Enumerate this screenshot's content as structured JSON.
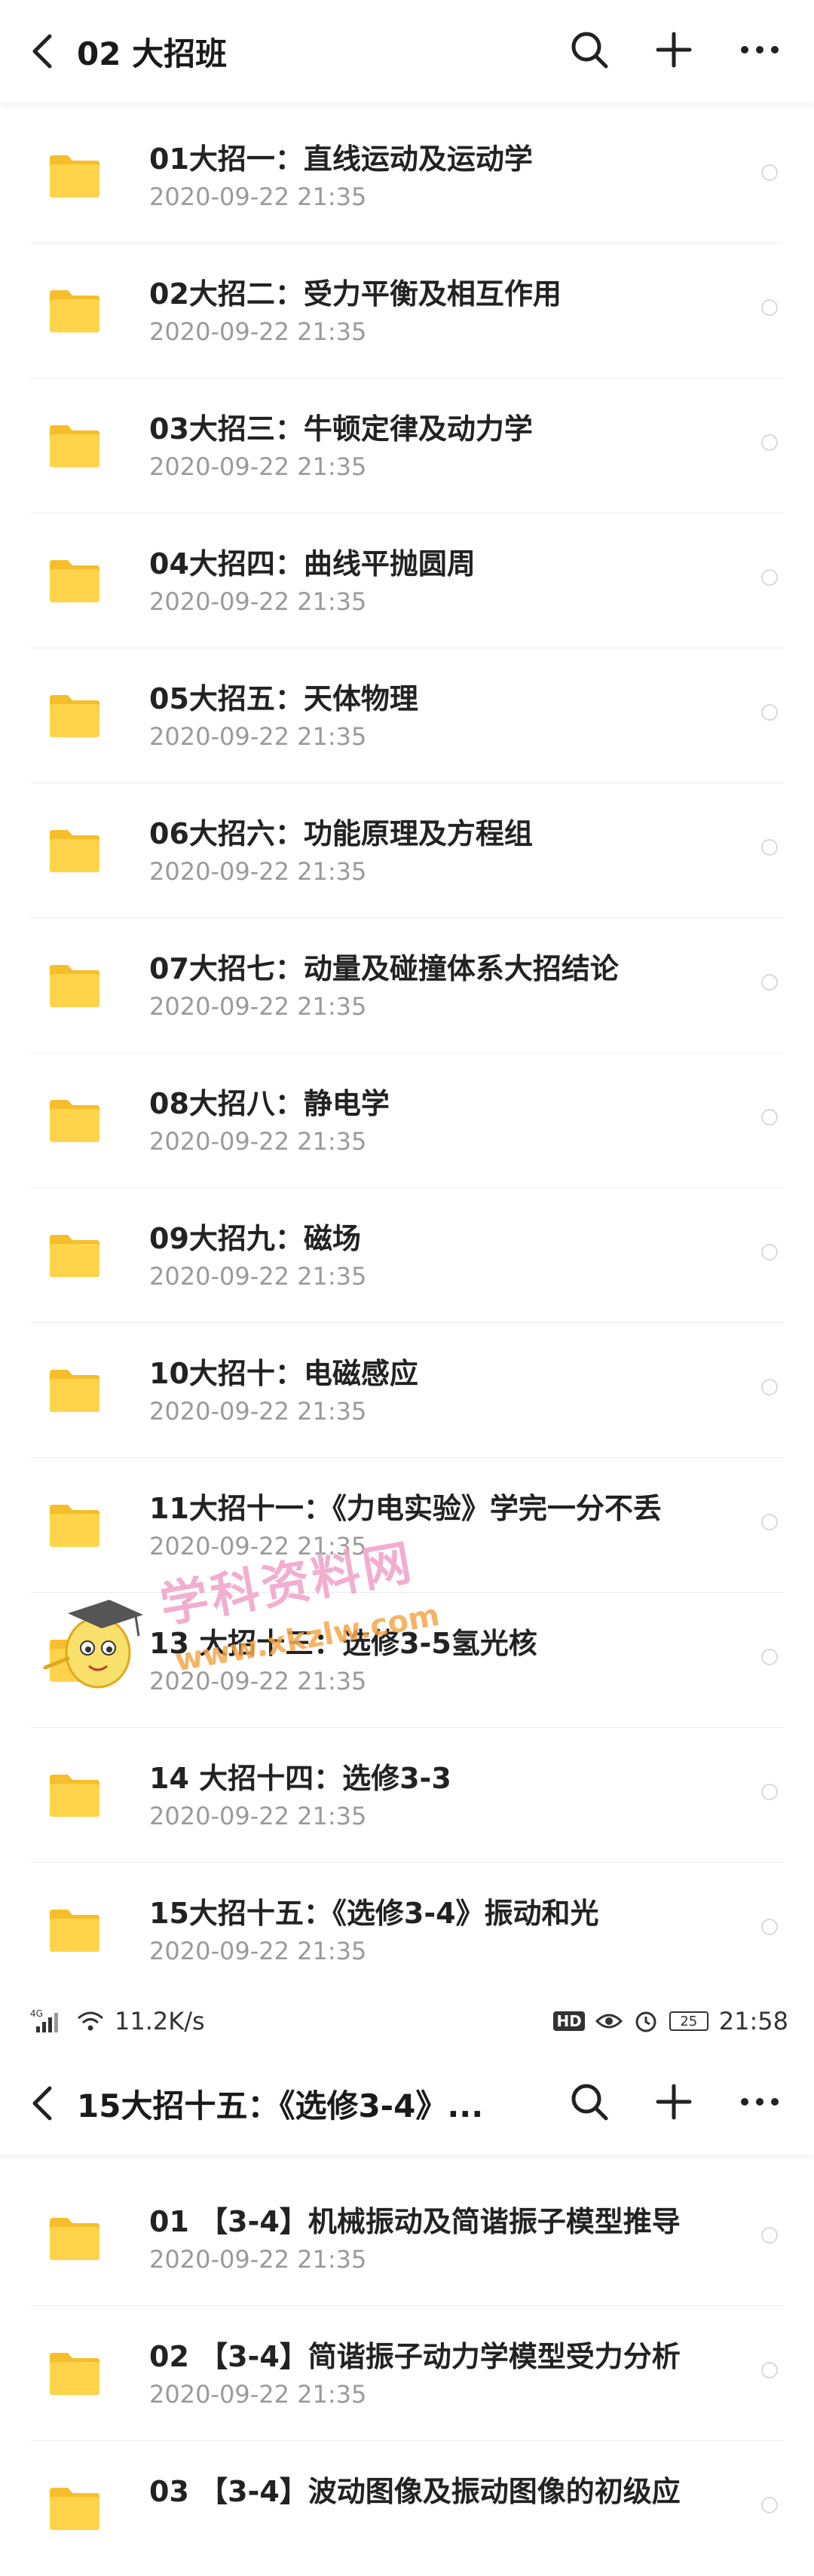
{
  "screen1": {
    "title": "02 大招班",
    "items": [
      {
        "name": "01大招一：直线运动及运动学",
        "date": "2020-09-22  21:35"
      },
      {
        "name": "02大招二：受力平衡及相互作用",
        "date": "2020-09-22  21:35"
      },
      {
        "name": "03大招三：牛顿定律及动力学",
        "date": "2020-09-22  21:35"
      },
      {
        "name": "04大招四：曲线平抛圆周",
        "date": "2020-09-22  21:35"
      },
      {
        "name": "05大招五：天体物理",
        "date": "2020-09-22  21:35"
      },
      {
        "name": "06大招六：功能原理及方程组",
        "date": "2020-09-22  21:35"
      },
      {
        "name": "07大招七：动量及碰撞体系大招结论",
        "date": "2020-09-22  21:35"
      },
      {
        "name": "08大招八：静电学",
        "date": "2020-09-22  21:35"
      },
      {
        "name": "09大招九：磁场",
        "date": "2020-09-22  21:35"
      },
      {
        "name": "10大招十：电磁感应",
        "date": "2020-09-22  21:35"
      },
      {
        "name": "11大招十一：《力电实验》学完一分不丢",
        "date": "2020-09-22  21:35"
      },
      {
        "name": "13 大招十三：选修3-5氢光核",
        "date": "2020-09-22  21:35"
      },
      {
        "name": "14 大招十四：选修3-3",
        "date": "2020-09-22  21:35"
      },
      {
        "name": "15大招十五：《选修3-4》振动和光",
        "date": "2020-09-22  21:35"
      }
    ]
  },
  "status_bar": {
    "network": "4G",
    "speed": "11.2K/s",
    "hd": "HD",
    "battery": "25",
    "time": "21:58"
  },
  "screen2": {
    "title": "15大招十五：《选修3-4》...",
    "items": [
      {
        "name": "01 【3-4】机械振动及简谐振子模型推导",
        "date": "2020-09-22  21:35"
      },
      {
        "name": "02 【3-4】简谐振子动力学模型受力分析",
        "date": "2020-09-22  21:35"
      },
      {
        "name": "03 【3-4】波动图像及振动图像的初级应",
        "date": ""
      }
    ]
  },
  "watermark": {
    "text": "学科资料网",
    "url": "www.xkzlw.com"
  },
  "colors": {
    "folder": "#FFD44A",
    "folder_tab": "#F5BE2A",
    "divider": "#ECECEC",
    "date": "#9A9A9A"
  },
  "icons": [
    "back-arrow-icon",
    "search-icon",
    "plus-icon",
    "more-icon",
    "folder-icon",
    "radio-icon",
    "signal-icon",
    "wifi-icon",
    "eye-icon",
    "alarm-icon",
    "battery-icon"
  ]
}
